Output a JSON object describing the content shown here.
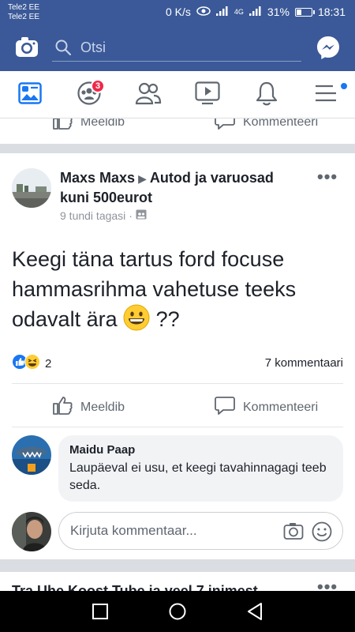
{
  "status_bar": {
    "carrier_1": "Tele2 EE",
    "carrier_2": "Tele2 EE",
    "network_speed": "0 K/s",
    "network_type": "4G",
    "battery": "31%",
    "time": "18:31"
  },
  "header": {
    "search_placeholder": "Otsi",
    "brand_color": "#3b5998"
  },
  "nav": {
    "tabs": [
      {
        "icon": "news-feed-icon",
        "active": true
      },
      {
        "icon": "groups-icon",
        "badge": "3"
      },
      {
        "icon": "friends-icon"
      },
      {
        "icon": "watch-icon"
      },
      {
        "icon": "notifications-icon"
      },
      {
        "icon": "menu-icon",
        "dot": true
      }
    ]
  },
  "prev_post": {
    "like_label": "Meeldib",
    "comment_label": "Kommenteeri"
  },
  "post": {
    "author": "Maxs Maxs",
    "group": "Autod ja varuosad kuni 500eurot",
    "time": "9 tundi tagasi",
    "privacy_icon": "group-privacy-icon",
    "text_before_emoji": "Keegi täna tartus ford focuse hammasrihma vahetuse teeks odavalt ära",
    "text_after_emoji": "??",
    "reaction_count": "2",
    "comments_count": "7 kommentaari",
    "like_label": "Meeldib",
    "comment_label": "Kommenteeri",
    "top_comment": {
      "author": "Maidu Paap",
      "text": "Laupäeval ei usu, et keegi tavahinnagagi teeb seda."
    },
    "comment_placeholder": "Kirjuta kommentaar..."
  },
  "next_post": {
    "header_partial": "Tra Uhe Koost Tube ja veel 7 inimest"
  }
}
